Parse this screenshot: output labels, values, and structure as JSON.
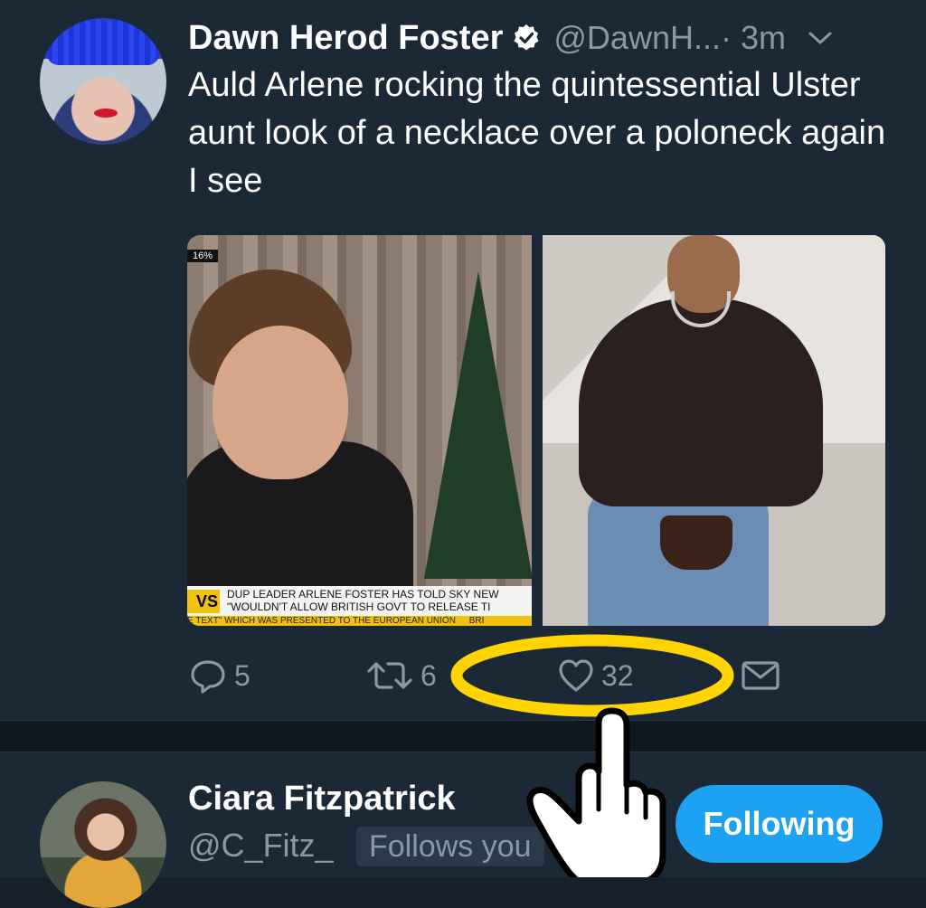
{
  "tweet": {
    "author_name": "Dawn Herod Foster",
    "author_handle": "@DawnH...",
    "time": "· 3m",
    "text": "Auld Arlene rocking the quintessential Ulster aunt look of a necklace over a poloneck again I see",
    "media": {
      "left_image": {
        "badge": "16%",
        "ticker_tag": "VS",
        "ticker_line1": "DUP LEADER ARLENE FOSTER HAS TOLD SKY NEW",
        "ticker_line2": "\"WOULDN'T ALLOW BRITISH GOVT TO RELEASE TI",
        "ticker_line3": "E TEXT\" WHICH WAS PRESENTED TO THE EUROPEAN UNION",
        "ticker_line3_suffix": "BRI"
      }
    },
    "actions": {
      "reply_count": "5",
      "retweet_count": "6",
      "like_count": "32"
    },
    "icons": {
      "verified": "verified-badge-icon",
      "more": "chevron-down-icon",
      "reply": "reply-icon",
      "retweet": "retweet-icon",
      "like": "heart-icon",
      "dm": "envelope-icon"
    }
  },
  "annotations": {
    "highlight_color": "#ffd400",
    "pointer": "pointing-hand-icon"
  },
  "suggested_user": {
    "name": "Ciara Fitzpatrick",
    "handle": "@C_Fitz_",
    "follows_you": "Follows you",
    "follow_button": "Following"
  },
  "colors": {
    "background": "#15202b",
    "card": "#1b2836",
    "secondary_text": "#8899a6",
    "accent": "#1da1f2"
  }
}
